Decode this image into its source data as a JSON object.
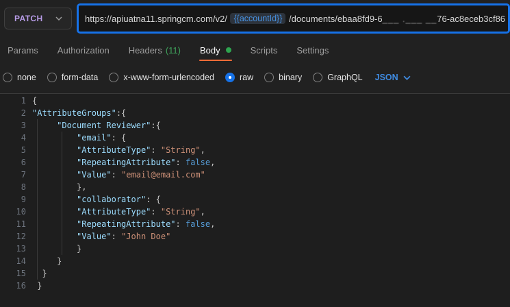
{
  "request": {
    "method": "PATCH",
    "url": {
      "prefix": "https://apiuatna11.springcm.com/v2/ ",
      "variable": "{{accountId}}",
      "path_before_caret": " /documents/eb",
      "path_after_caret": "aa8fd9-6",
      "redacted": "___ .___ __",
      "path_suffix": "76-ac8eceb3cf86"
    }
  },
  "tabs": [
    {
      "label": "Params"
    },
    {
      "label": "Authorization"
    },
    {
      "label": "Headers",
      "count": "(11)"
    },
    {
      "label": "Body",
      "active": true,
      "dot": true
    },
    {
      "label": "Scripts"
    },
    {
      "label": "Settings"
    }
  ],
  "body_types": [
    {
      "label": "none",
      "selected": false
    },
    {
      "label": "form-data",
      "selected": false
    },
    {
      "label": "x-www-form-urlencoded",
      "selected": false
    },
    {
      "label": "raw",
      "selected": true
    },
    {
      "label": "binary",
      "selected": false
    },
    {
      "label": "GraphQL",
      "selected": false
    }
  ],
  "raw_format": {
    "label": "JSON"
  },
  "editor": {
    "lines": [
      "{",
      "\"AttributeGroups\":{",
      "     \"Document Reviewer\":{",
      "         \"email\": {",
      "         \"AttributeType\": \"String\",",
      "         \"RepeatingAttribute\": false,",
      "         \"Value\": \"email@email.com\"",
      "         },",
      "         \"collaborator\": {",
      "         \"AttributeType\": \"String\",",
      "         \"RepeatingAttribute\": false,",
      "         \"Value\": \"John Doe\"",
      "         }",
      "     }",
      "  }",
      " }"
    ]
  },
  "colors": {
    "method_patch": "#b89ce8",
    "focus_border": "#1672e8",
    "active_tab_underline": "#ff6c37",
    "headers_count_green": "#3fa45c",
    "unsaved_dot_green": "#2ea44f",
    "json_dropdown_blue": "#3f8ae0",
    "variable_chip_blue": "#4792e2",
    "code_key": "#9cdcfe",
    "code_string": "#ce9178",
    "code_keyword": "#569cd6"
  }
}
